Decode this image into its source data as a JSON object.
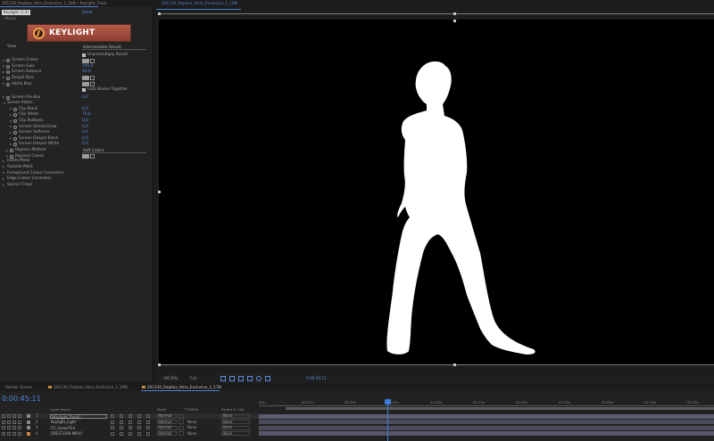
{
  "effect_controls": {
    "tab_title": "201230_Rapbox_Hero_Exclusive_1_16N • Keylight_Track",
    "effect_badge": "Keylight (1.2)",
    "reset_label": "Reset",
    "about_label": "About",
    "logo_text": "KEYLIGHT",
    "properties": [
      {
        "label": "View",
        "value": "Intermediate Result",
        "kind": "dropdown"
      },
      {
        "label": "",
        "value": "Unpremultiply Result",
        "kind": "checkbox"
      },
      {
        "label": "Screen Colour",
        "value": "",
        "kind": "colour"
      },
      {
        "label": "Screen Gain",
        "value": "100,0",
        "kind": "number"
      },
      {
        "label": "Screen Balance",
        "value": "50,0",
        "kind": "number"
      },
      {
        "label": "Despill Bias",
        "value": "",
        "kind": "colour"
      },
      {
        "label": "Alpha Bias",
        "value": "",
        "kind": "colour"
      },
      {
        "label": "",
        "value": "Lock Biases Together",
        "kind": "checkbox"
      },
      {
        "label": "Screen Pre-blur",
        "value": "0,0",
        "kind": "number"
      },
      {
        "label": "Screen Matte",
        "value": "",
        "kind": "group"
      },
      {
        "label": "Clip Black",
        "value": "0,0",
        "kind": "number"
      },
      {
        "label": "Clip White",
        "value": "70,0",
        "kind": "number"
      },
      {
        "label": "Clip Rollback",
        "value": "0,0",
        "kind": "number"
      },
      {
        "label": "Screen Shrink/Grow",
        "value": "0,0",
        "kind": "number"
      },
      {
        "label": "Screen Softness",
        "value": "0,0",
        "kind": "number"
      },
      {
        "label": "Screen Despot Black",
        "value": "0,0",
        "kind": "number"
      },
      {
        "label": "Screen Despot White",
        "value": "0,0",
        "kind": "number"
      },
      {
        "label": "Replace Method",
        "value": "Soft Colour",
        "kind": "dropdown"
      },
      {
        "label": "Replace Colour",
        "value": "",
        "kind": "colour"
      }
    ],
    "groups": [
      "Inside Mask",
      "Outside Mask",
      "Foreground Colour Correction",
      "Edge Colour Correction",
      "Source Crops"
    ]
  },
  "viewer": {
    "tab_title": "201230_Rapbox_Hero_Exclusive_1_16N",
    "zoom": "(96,9%)",
    "resolution": "Full",
    "timecode": "0:00:45:11"
  },
  "timeline": {
    "tabs": [
      {
        "label": "Render Queue"
      },
      {
        "label": "201230_Rapbox_Hero_Exclusive_1_16N"
      },
      {
        "label": "201230_Rapbox_Hero_Exclusive_1_17N"
      }
    ],
    "timecode": "0:00:45:11",
    "column_headers": {
      "layer_name": "Layer Name",
      "mode": "Mode",
      "trkmat": "T TrkMat",
      "parent": "Parent & Link"
    },
    "ruler_ticks": [
      "00s",
      "00:15s",
      "00:30s",
      "00:45s",
      "01:00s",
      "01:15s",
      "01:30s",
      "01:45s",
      "02:00s",
      "02:15s",
      "02:30s"
    ],
    "layers": [
      {
        "num": "1",
        "name": "[Keylight_Track]",
        "mode": "Normal",
        "trkmat": "",
        "parent": "None",
        "color": "#8a8a8a"
      },
      {
        "num": "2",
        "name": "Keylight_Light",
        "mode": "Normal",
        "trkmat": "None",
        "parent": "None",
        "color": "#8a8a8a"
      },
      {
        "num": "3",
        "name": "CC_GreenTint",
        "mode": "Normal",
        "trkmat": "None",
        "parent": "None",
        "color": "#8a8a8a"
      },
      {
        "num": "4",
        "name": "[DSCF3104.MOV]",
        "mode": "Normal",
        "trkmat": "None",
        "parent": "None",
        "color": "#c98a3e"
      }
    ]
  },
  "colors": {
    "accent": "#4f86dd",
    "logo": "#a84f40"
  }
}
